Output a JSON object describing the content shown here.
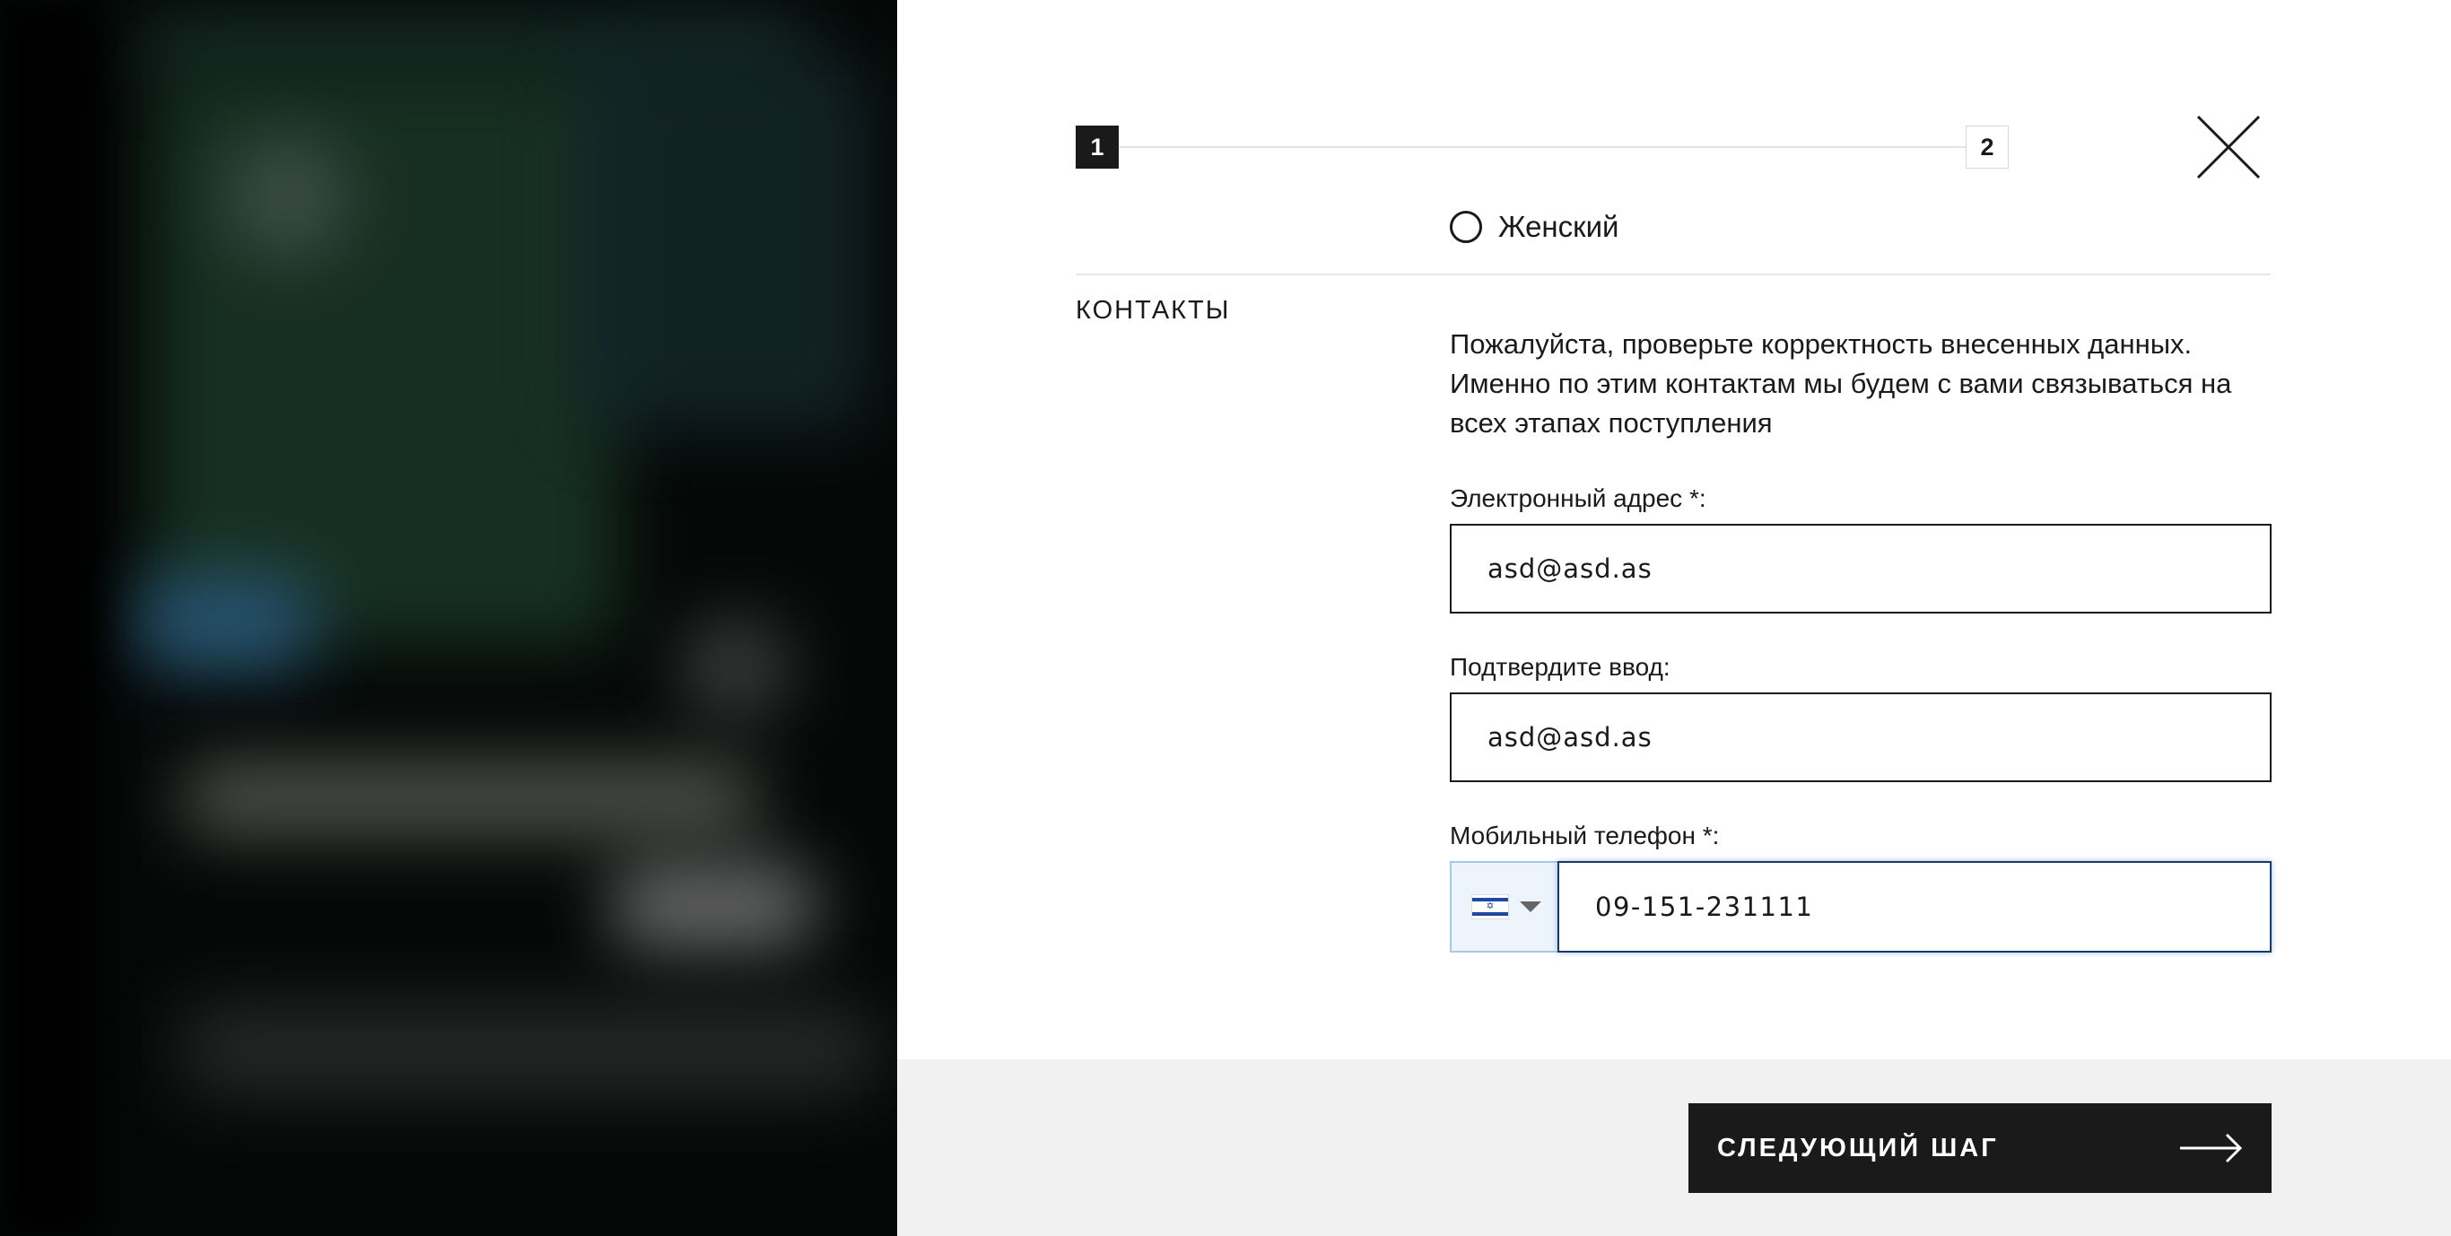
{
  "colors": {
    "accent_dark": "#1a1a1a",
    "panel_bg": "#ffffff",
    "footer_bg": "#f1f1f1",
    "focus_border": "#1a3a66"
  },
  "stepper": {
    "steps": [
      {
        "label": "1",
        "state": "active"
      },
      {
        "label": "2",
        "state": "inactive"
      }
    ],
    "close_icon": "close-icon"
  },
  "gender": {
    "option_label": "Женский",
    "selected": false
  },
  "contacts": {
    "section_title": "КОНТАКТЫ",
    "info_text": "Пожалуйста, проверьте корректность внесенных данных. Именно по этим контактам мы будем с вами связываться на всех этапах поступления",
    "email": {
      "label": "Электронный адрес *:",
      "value": "asd@asd.as"
    },
    "email_confirm": {
      "label": "Подтвердите ввод:",
      "value": "asd@asd.as"
    },
    "phone": {
      "label": "Мобильный телефон *:",
      "country_icon": "israel-flag-icon",
      "value": "09-151-231111"
    }
  },
  "footer": {
    "next_label": "СЛЕДУЮЩИЙ ШАГ",
    "next_icon": "arrow-right-icon"
  }
}
